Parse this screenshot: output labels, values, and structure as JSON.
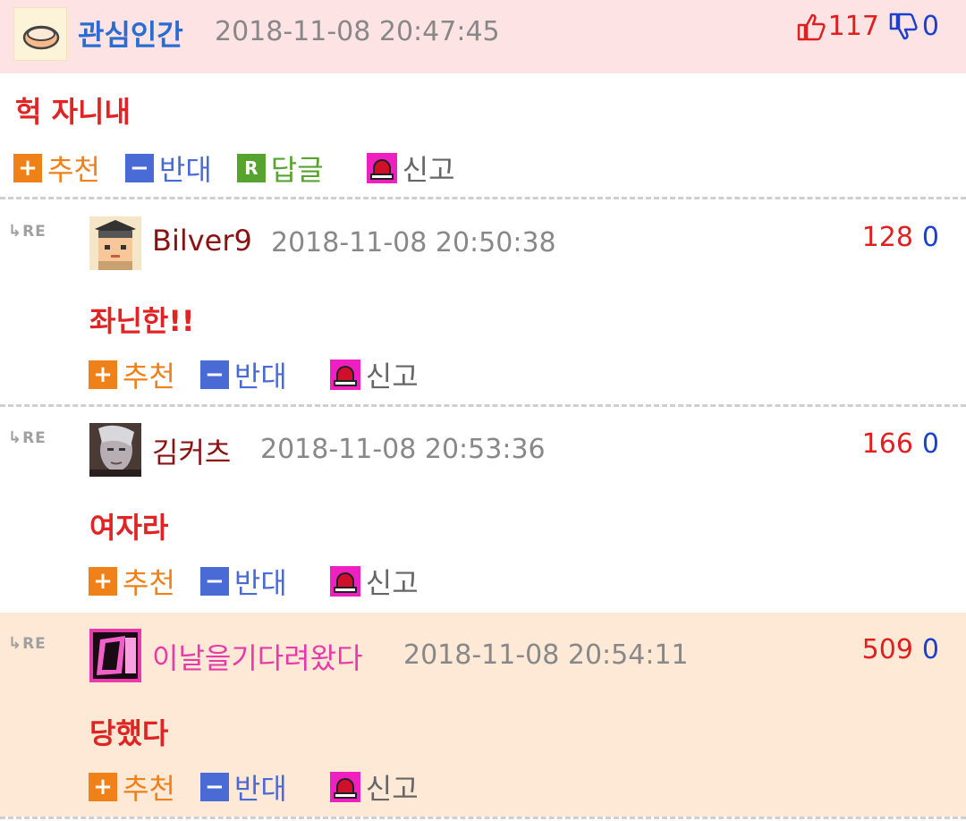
{
  "post": {
    "nickname": "관심인간",
    "datetime": "2018-11-08 20:47:45",
    "upvotes": "117",
    "downvotes": "0",
    "body": "헉 자니내",
    "actions": {
      "recommend": "추천",
      "oppose": "반대",
      "reply": "답글",
      "report": "신고",
      "reply_box": "R"
    }
  },
  "re_label": "RE",
  "replies": [
    {
      "nickname": "Bilver9",
      "datetime": "2018-11-08 20:50:38",
      "upvotes": "128",
      "downvotes": "0",
      "body": "좌닌한!!",
      "actions": {
        "recommend": "추천",
        "oppose": "반대",
        "report": "신고"
      }
    },
    {
      "nickname": "김커츠",
      "datetime": "2018-11-08 20:53:36",
      "upvotes": "166",
      "downvotes": "0",
      "body": "여자라",
      "actions": {
        "recommend": "추천",
        "oppose": "반대",
        "report": "신고"
      }
    },
    {
      "nickname": "이날을기다려왔다",
      "datetime": "2018-11-08 20:54:11",
      "upvotes": "509",
      "downvotes": "0",
      "body": "당했다",
      "actions": {
        "recommend": "추천",
        "oppose": "반대",
        "report": "신고"
      }
    }
  ],
  "icons": {
    "thumb_up": "thumb-up-icon",
    "thumb_down": "thumb-down-icon",
    "plus": "plus-icon",
    "minus": "minus-icon",
    "reply": "reply-icon",
    "report": "siren-icon",
    "re_arrow": "reply-arrow-icon"
  },
  "colors": {
    "header_bg": "#fde3e4",
    "highlight_bg": "#fde9d6",
    "nick_blue": "#2a6dd2",
    "nick_dark_red": "#8a1212",
    "nick_pink": "#e83aa8",
    "body_red": "#e02424",
    "up_red": "#e02020",
    "down_blue": "#1a40d0"
  }
}
